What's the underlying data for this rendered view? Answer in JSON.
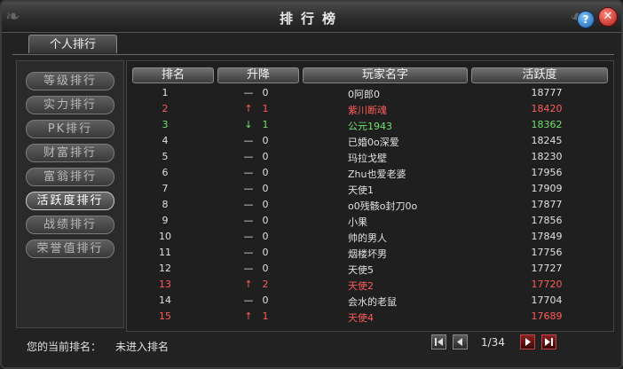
{
  "window": {
    "title": "排行榜"
  },
  "tabs": [
    {
      "label": "个人排行"
    }
  ],
  "sidebar": {
    "items": [
      {
        "label": "等级排行"
      },
      {
        "label": "实力排行"
      },
      {
        "label": "PK排行"
      },
      {
        "label": "财富排行"
      },
      {
        "label": "富翁排行"
      },
      {
        "label": "活跃度排行",
        "active": true
      },
      {
        "label": "战绩排行"
      },
      {
        "label": "荣誉值排行"
      }
    ]
  },
  "table": {
    "headers": [
      "排名",
      "升降",
      "玩家名字",
      "活跃度"
    ],
    "rows": [
      {
        "rank": "1",
        "mark": "—",
        "delta": "0",
        "name": "0阿郎0",
        "score": "18777",
        "color": "normal"
      },
      {
        "rank": "2",
        "mark": "↑",
        "delta": "1",
        "name": "紫川断魂",
        "score": "18420",
        "color": "red"
      },
      {
        "rank": "3",
        "mark": "↓",
        "delta": "1",
        "name": "公元1943",
        "score": "18362",
        "color": "green"
      },
      {
        "rank": "4",
        "mark": "—",
        "delta": "0",
        "name": "已婚0o深爱",
        "score": "18245",
        "color": "normal"
      },
      {
        "rank": "5",
        "mark": "—",
        "delta": "0",
        "name": "玛拉戈壁",
        "score": "18230",
        "color": "normal"
      },
      {
        "rank": "6",
        "mark": "—",
        "delta": "0",
        "name": "Zhu也爱老婆",
        "score": "17956",
        "color": "normal"
      },
      {
        "rank": "7",
        "mark": "—",
        "delta": "0",
        "name": "天使1",
        "score": "17909",
        "color": "normal"
      },
      {
        "rank": "8",
        "mark": "—",
        "delta": "0",
        "name": "o0残骸o封刀0o",
        "score": "17877",
        "color": "normal"
      },
      {
        "rank": "9",
        "mark": "—",
        "delta": "0",
        "name": "小果",
        "score": "17856",
        "color": "normal"
      },
      {
        "rank": "10",
        "mark": "—",
        "delta": "0",
        "name": "帅的男人",
        "score": "17849",
        "color": "normal"
      },
      {
        "rank": "11",
        "mark": "—",
        "delta": "0",
        "name": "烟楼坏男",
        "score": "17756",
        "color": "normal"
      },
      {
        "rank": "12",
        "mark": "—",
        "delta": "0",
        "name": "天使5",
        "score": "17727",
        "color": "normal"
      },
      {
        "rank": "13",
        "mark": "↑",
        "delta": "2",
        "name": "天使2",
        "score": "17720",
        "color": "red"
      },
      {
        "rank": "14",
        "mark": "—",
        "delta": "0",
        "name": "会水的老鼠",
        "score": "17704",
        "color": "normal"
      },
      {
        "rank": "15",
        "mark": "↑",
        "delta": "1",
        "name": "天使4",
        "score": "17689",
        "color": "red"
      }
    ]
  },
  "footer": {
    "label": "您的当前排名：",
    "value": "未进入排名"
  },
  "pagination": {
    "current": "1/34"
  },
  "colors": {
    "up": "#ff5a5a",
    "down": "#6ee06e",
    "text": "#e0e0e0"
  },
  "icons": [
    "help-icon",
    "close-icon",
    "first-page-icon",
    "prev-page-icon",
    "next-page-icon",
    "last-page-icon"
  ]
}
